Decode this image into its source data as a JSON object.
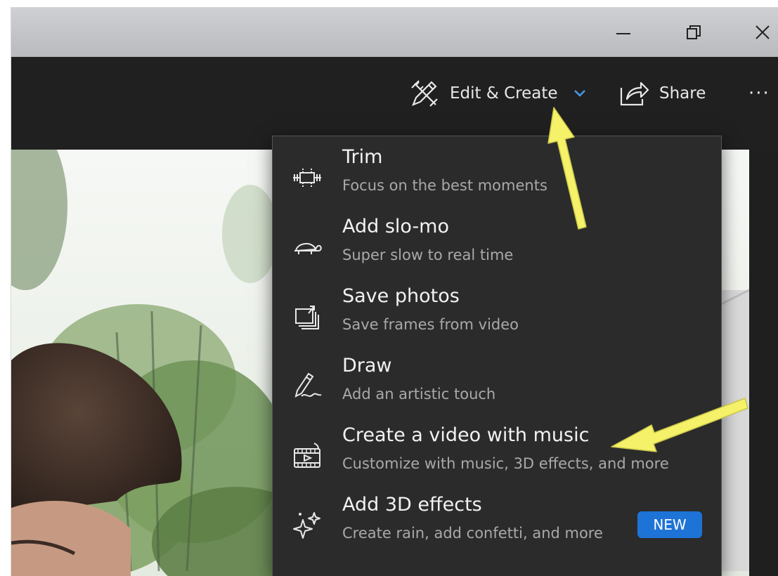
{
  "window": {
    "minimize_icon": "minimize-icon",
    "restore_icon": "restore-icon",
    "close_icon": "close-icon"
  },
  "toolbar": {
    "edit_create_label": "Edit & Create",
    "share_label": "Share",
    "more_label": "···"
  },
  "menu": {
    "items": [
      {
        "title": "Trim",
        "subtitle": "Focus on the best moments",
        "icon": "trim-icon"
      },
      {
        "title": "Add slo-mo",
        "subtitle": "Super slow to real time",
        "icon": "turtle-icon"
      },
      {
        "title": "Save photos",
        "subtitle": "Save frames from video",
        "icon": "save-photos-icon"
      },
      {
        "title": "Draw",
        "subtitle": "Add an artistic touch",
        "icon": "pen-icon"
      },
      {
        "title": "Create a video with music",
        "subtitle": "Customize with music, 3D effects, and more",
        "icon": "video-film-icon"
      },
      {
        "title": "Add 3D effects",
        "subtitle": "Create rain, add confetti, and more",
        "icon": "sparkles-icon",
        "badge": "NEW"
      }
    ]
  },
  "colors": {
    "menu_bg": "#2b2b2b",
    "toolbar_bg": "#202020",
    "accent": "#1e73d6",
    "chevron": "#4a9ae8",
    "annotation_arrow": "#f5f26a"
  }
}
